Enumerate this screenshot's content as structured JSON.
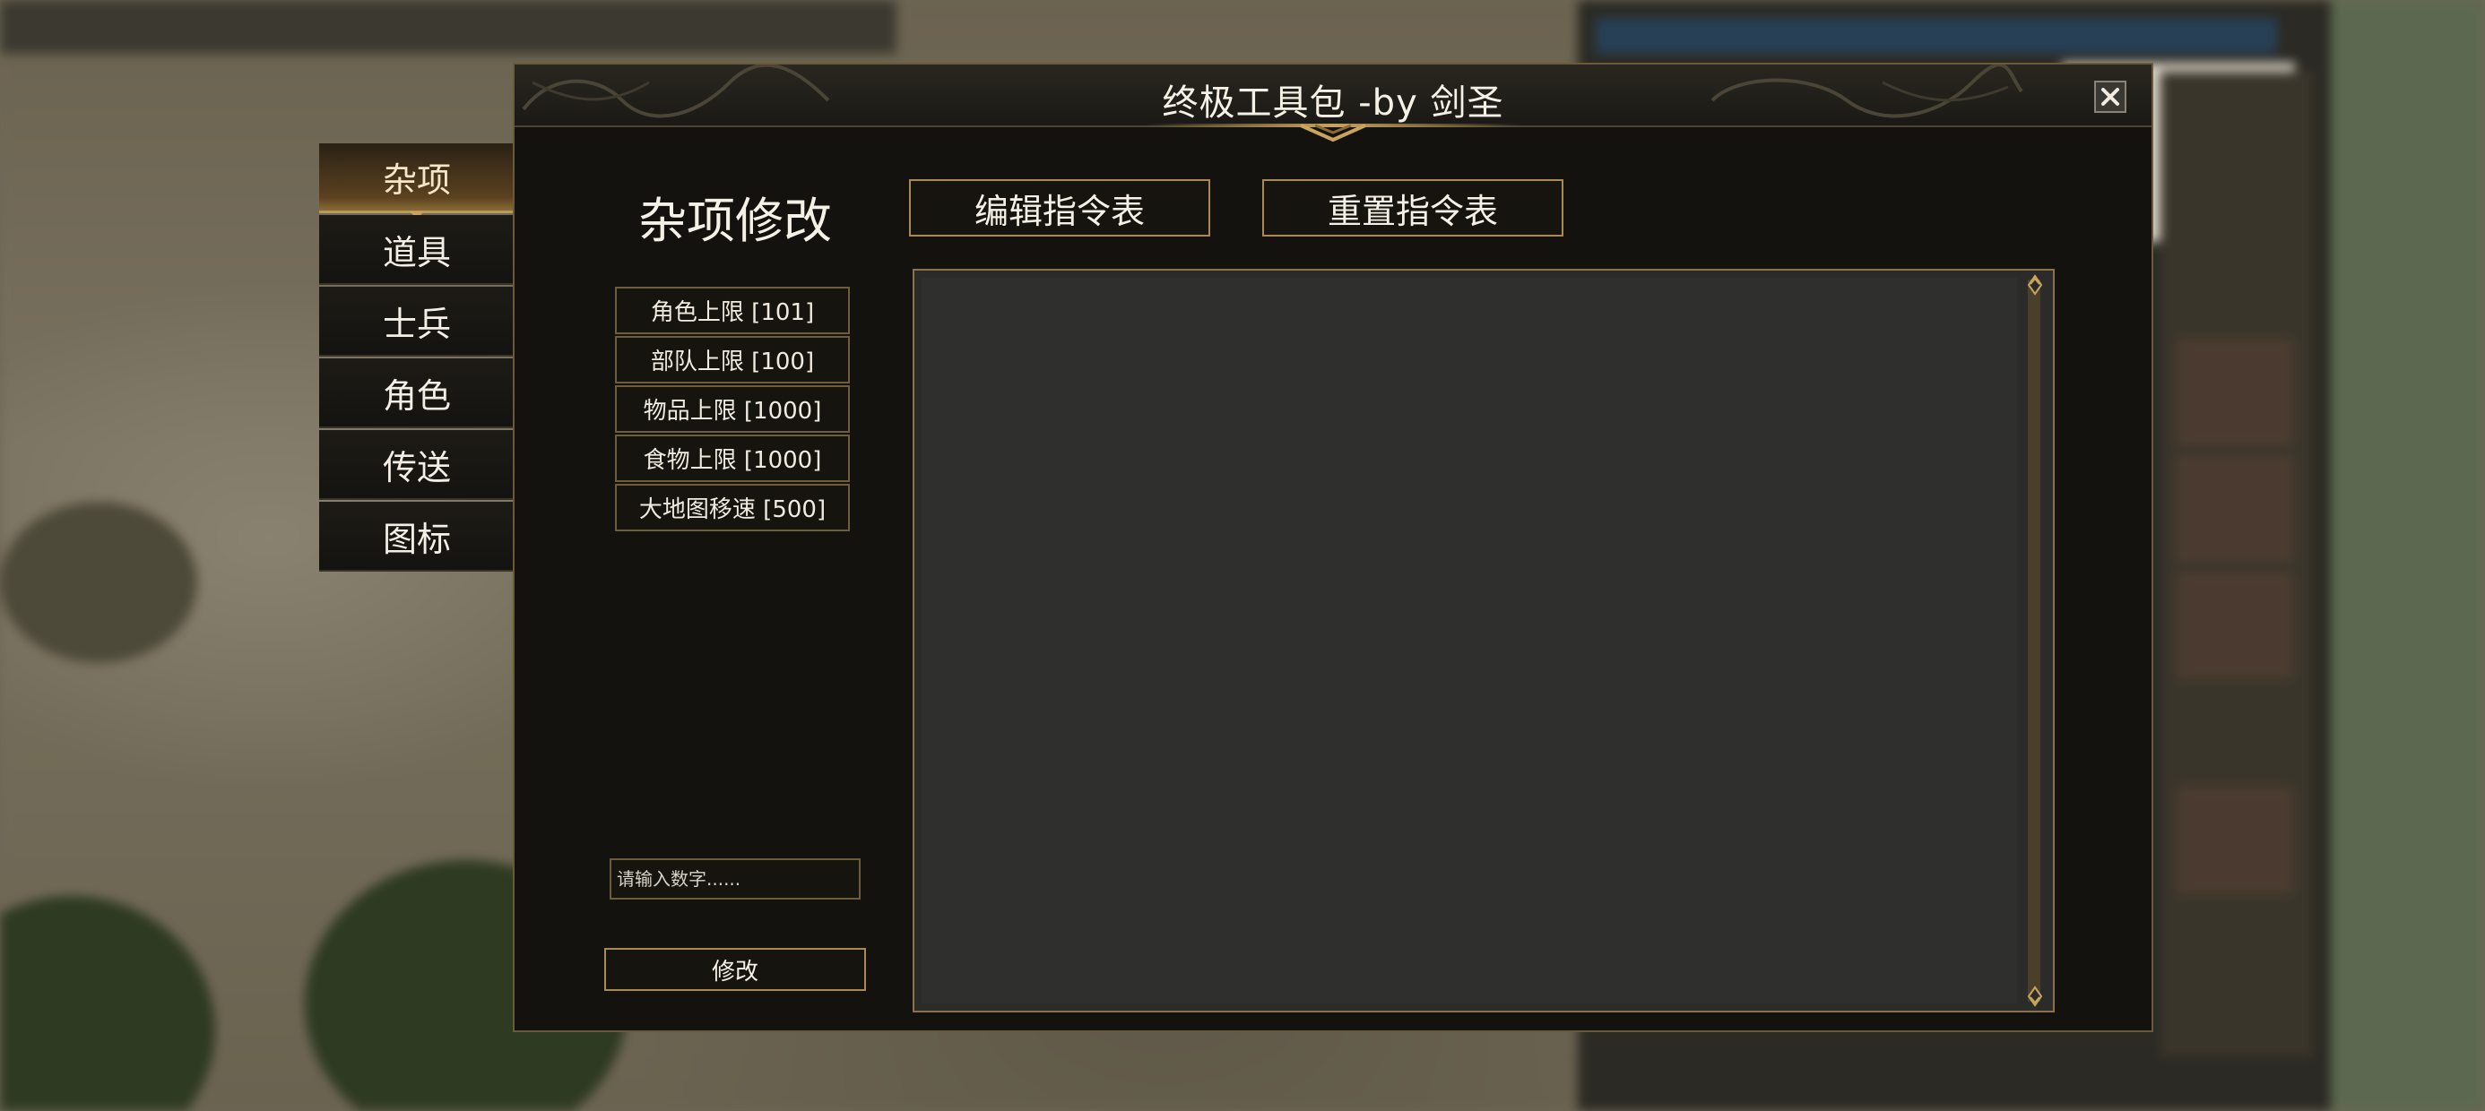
{
  "window": {
    "title": "终极工具包 -by 剑圣"
  },
  "tabs": [
    {
      "label": "杂项",
      "active": true
    },
    {
      "label": "道具",
      "active": false
    },
    {
      "label": "士兵",
      "active": false
    },
    {
      "label": "角色",
      "active": false
    },
    {
      "label": "传送",
      "active": false
    },
    {
      "label": "图标",
      "active": false
    }
  ],
  "panel": {
    "heading": "杂项修改",
    "edit_button": "编辑指令表",
    "reset_button": "重置指令表",
    "items": [
      "角色上限 [101]",
      "部队上限 [100]",
      "物品上限 [1000]",
      "食物上限 [1000]",
      "大地图移速 [500]"
    ],
    "input": {
      "placeholder": "请输入数字......",
      "value": ""
    },
    "modify_button": "修改",
    "command_text": ""
  },
  "colors": {
    "accent": "#a88a52",
    "window_bg": "#13120e",
    "text": "#f6f1e6"
  },
  "icons": {
    "close": "close-icon",
    "scroll_up": "scroll-up-arrow-icon",
    "scroll_down": "scroll-down-arrow-icon"
  }
}
